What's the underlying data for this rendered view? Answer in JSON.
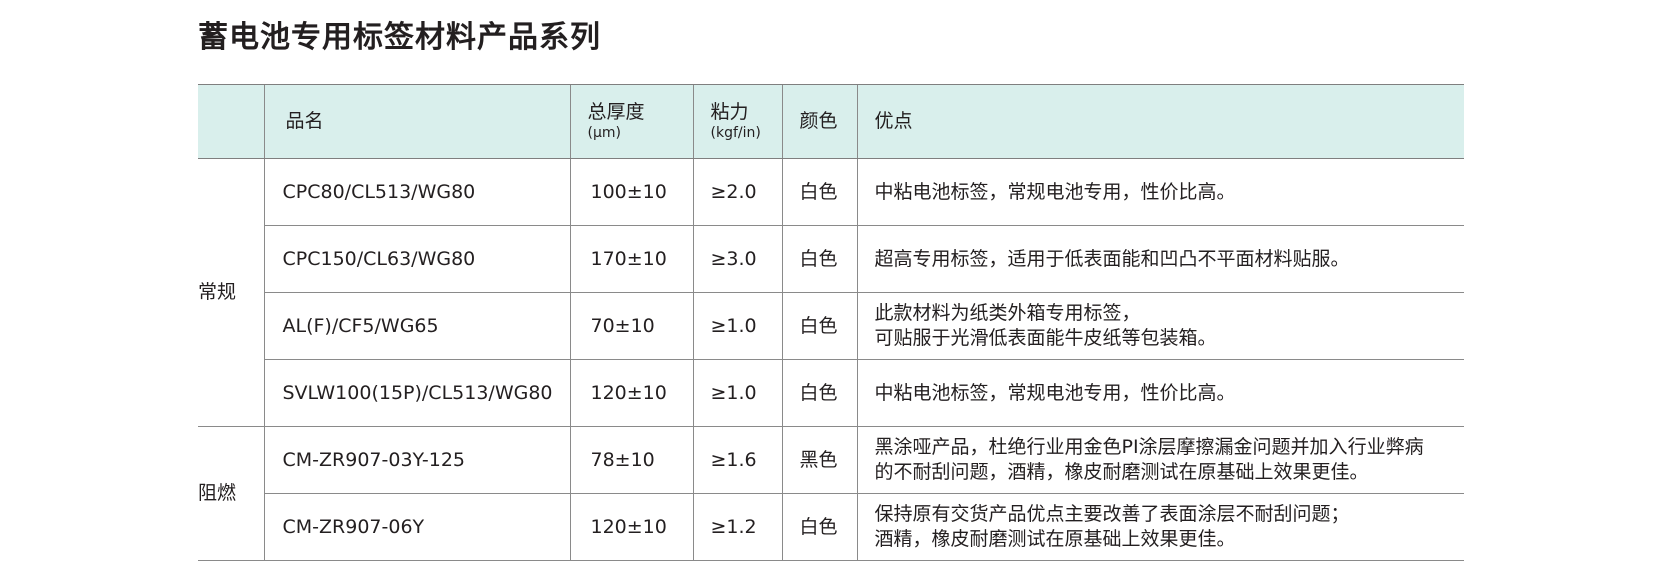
{
  "title": "蓄电池专用标签材料产品系列",
  "headers": {
    "category": "",
    "name": "品名",
    "thickness": "总厚度",
    "thickness_unit": "(μm)",
    "adhesion": "粘力",
    "adhesion_unit": "(kgf/in)",
    "color": "颜色",
    "advantages": "优点"
  },
  "groups": [
    {
      "category": "常规",
      "rows": [
        {
          "name": "CPC80/CL513/WG80",
          "thickness": "100±10",
          "adhesion": "≥2.0",
          "color": "白色",
          "advantages": [
            "中粘电池标签，常规电池专用，性价比高。"
          ]
        },
        {
          "name": "CPC150/CL63/WG80",
          "thickness": "170±10",
          "adhesion": "≥3.0",
          "color": "白色",
          "advantages": [
            "超高专用标签，适用于低表面能和凹凸不平面材料贴服。"
          ]
        },
        {
          "name": "AL(F)/CF5/WG65",
          "thickness": "70±10",
          "adhesion": "≥1.0",
          "color": "白色",
          "advantages": [
            "此款材料为纸类外箱专用标签，",
            "可贴服于光滑低表面能牛皮纸等包装箱。"
          ]
        },
        {
          "name": "SVLW100(15P)/CL513/WG80",
          "thickness": "120±10",
          "adhesion": "≥1.0",
          "color": "白色",
          "advantages": [
            "中粘电池标签，常规电池专用，性价比高。"
          ]
        }
      ]
    },
    {
      "category": "阻燃",
      "rows": [
        {
          "name": "CM-ZR907-03Y-125",
          "thickness": "78±10",
          "adhesion": "≥1.6",
          "color": "黑色",
          "advantages": [
            "黑涂哑产品，杜绝行业用金色PI涂层摩擦漏金问题并加入行业弊病",
            "的不耐刮问题，酒精，橡皮耐磨测试在原基础上效果更佳。"
          ]
        },
        {
          "name": "CM-ZR907-06Y",
          "thickness": "120±10",
          "adhesion": "≥1.2",
          "color": "白色",
          "advantages": [
            "保持原有交货产品优点主要改善了表面涂层不耐刮问题；",
            "酒精，橡皮耐磨测试在原基础上效果更佳。"
          ]
        }
      ]
    }
  ],
  "colors": {
    "header_bg": "#d9efec",
    "rule": "#8a8a8a",
    "text": "#231f20"
  }
}
